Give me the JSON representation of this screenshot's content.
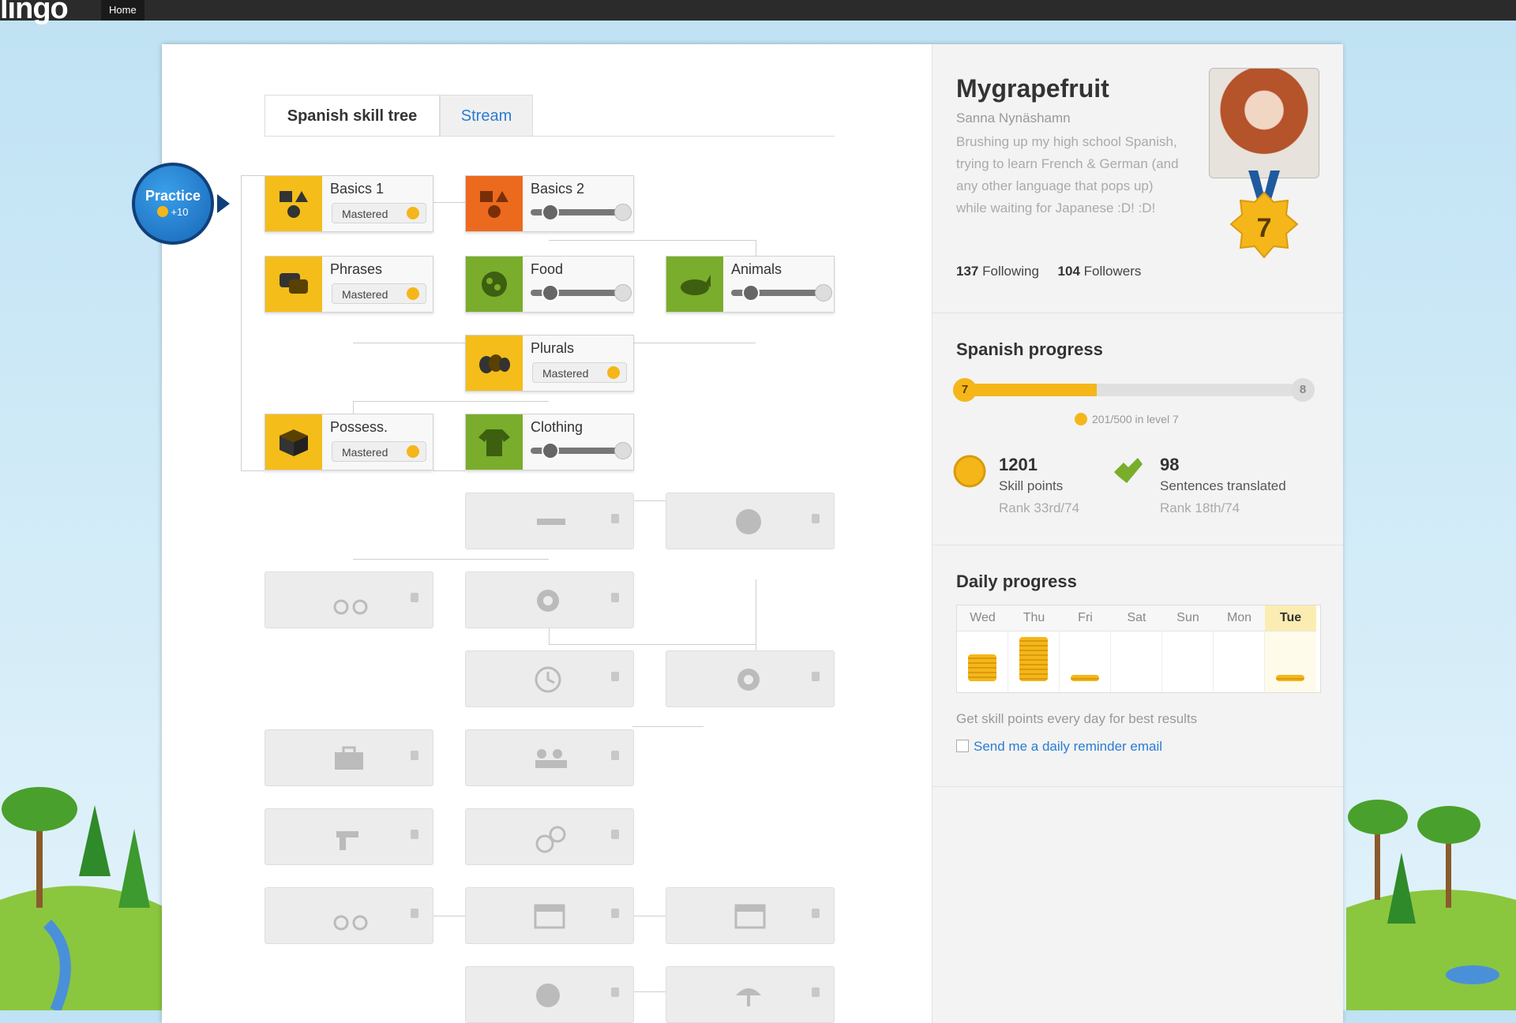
{
  "topbar": {
    "logo": "lingo",
    "nav": [
      "Home"
    ]
  },
  "tabs": {
    "skill_tree": "Spanish skill tree",
    "stream": "Stream"
  },
  "practice": {
    "label": "Practice",
    "points": "+10"
  },
  "skills": [
    {
      "name": "Basics 1",
      "status": "Mastered",
      "color": "#f4bd1a"
    },
    {
      "name": "Basics 2",
      "status": "",
      "color": "#ec6a1e"
    },
    {
      "name": "Phrases",
      "status": "Mastered",
      "color": "#f4bd1a"
    },
    {
      "name": "Food",
      "status": "",
      "color": "#79ad2b"
    },
    {
      "name": "Animals",
      "status": "",
      "color": "#79ad2b"
    },
    {
      "name": "Plurals",
      "status": "Mastered",
      "color": "#f4bd1a"
    },
    {
      "name": "Possess.",
      "status": "Mastered",
      "color": "#f4bd1a"
    },
    {
      "name": "Clothing",
      "status": "",
      "color": "#79ad2b"
    }
  ],
  "profile": {
    "username": "Mygrapefruit",
    "realname": "Sanna  Nynäshamn",
    "bio": "Brushing up my high school Spanish, trying to learn French & German (and any other language that pops up) while waiting for Japanese :D! :D!",
    "following_count": "137",
    "following_label": "Following",
    "followers_count": "104",
    "followers_label": "Followers",
    "level": "7"
  },
  "progress": {
    "title": "Spanish progress",
    "level_from": "7",
    "level_to": "8",
    "points_text": "201/500 in level 7",
    "fill_fraction": 0.4
  },
  "stats": {
    "skill_points": "1201",
    "skill_label": "Skill points",
    "skill_rank": "Rank 33rd/74",
    "sentences": "98",
    "sentences_label": "Sentences translated",
    "sentences_rank": "Rank 18th/74"
  },
  "daily": {
    "title": "Daily progress",
    "days": [
      "Wed",
      "Thu",
      "Fri",
      "Sat",
      "Sun",
      "Mon",
      "Tue"
    ],
    "hint": "Get skill points every day for best results",
    "reminder": "Send me a daily reminder email"
  },
  "colors": {
    "accent": "#2a7cd3",
    "gold": "#f4b619",
    "green": "#79ad2b"
  }
}
